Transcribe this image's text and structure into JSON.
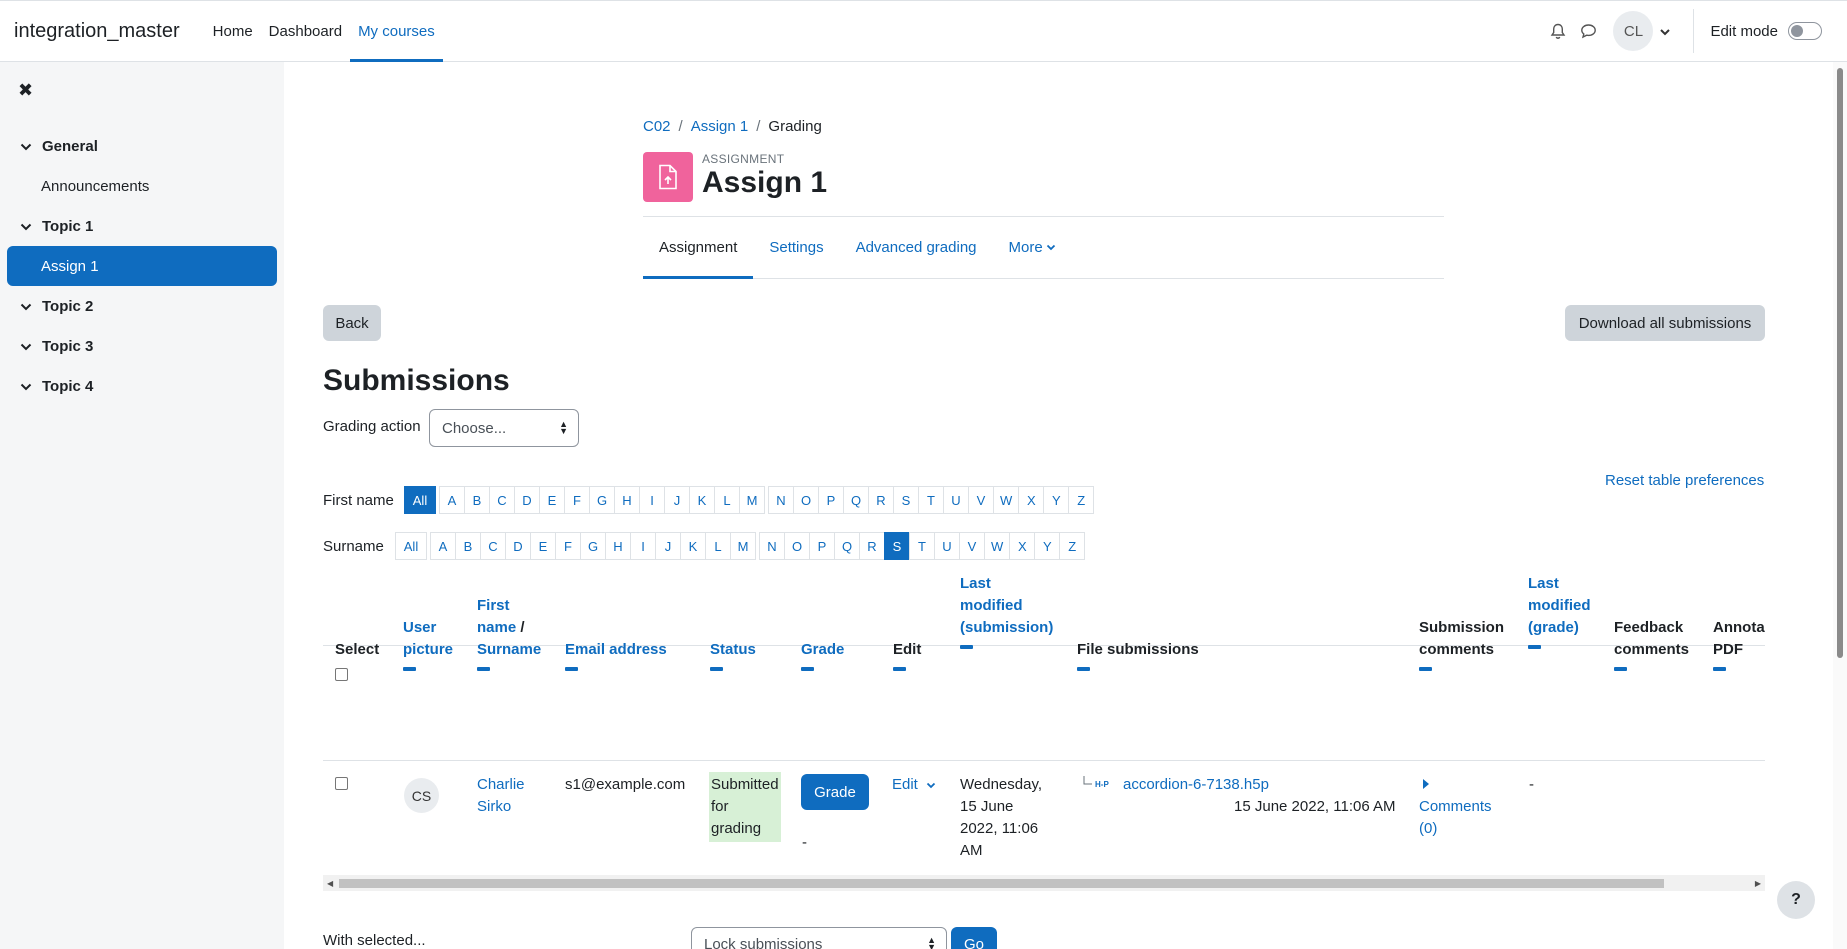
{
  "navbar": {
    "site_name": "integration_master",
    "items": [
      {
        "label": "Home"
      },
      {
        "label": "Dashboard"
      },
      {
        "label": "My courses"
      }
    ],
    "user_initials": "CL",
    "edit_mode_label": "Edit mode"
  },
  "sidebar": {
    "items": [
      {
        "label": "General",
        "type": "section"
      },
      {
        "label": "Announcements",
        "type": "sub"
      },
      {
        "label": "Topic 1",
        "type": "section"
      },
      {
        "label": "Assign 1",
        "type": "sub",
        "active": true
      },
      {
        "label": "Topic 2",
        "type": "section"
      },
      {
        "label": "Topic 3",
        "type": "section"
      },
      {
        "label": "Topic 4",
        "type": "section"
      }
    ]
  },
  "breadcrumb": [
    "C02",
    "Assign 1",
    "Grading"
  ],
  "activity": {
    "type_label": "ASSIGNMENT",
    "title": "Assign 1"
  },
  "tabs": [
    {
      "label": "Assignment",
      "active": true
    },
    {
      "label": "Settings"
    },
    {
      "label": "Advanced grading"
    },
    {
      "label": "More"
    }
  ],
  "buttons": {
    "back": "Back",
    "download_all": "Download all submissions",
    "grade": "Grade",
    "go": "Go",
    "help": "?"
  },
  "submissions": {
    "heading": "Submissions",
    "grading_action_label": "Grading action",
    "grading_action_value": "Choose...",
    "reset_prefs": "Reset table preferences",
    "first_name_label": "First name",
    "surname_label": "Surname",
    "letters_a_m": [
      "A",
      "B",
      "C",
      "D",
      "E",
      "F",
      "G",
      "H",
      "I",
      "J",
      "K",
      "L",
      "M"
    ],
    "letters_n_z": [
      "N",
      "O",
      "P",
      "Q",
      "R",
      "S",
      "T",
      "U",
      "V",
      "W",
      "X",
      "Y",
      "Z"
    ],
    "all_label": "All",
    "first_name_selected": "All",
    "surname_selected": "S"
  },
  "table": {
    "headers": {
      "select": "Select",
      "user_picture_1": "User",
      "user_picture_2": "picture",
      "first_name_1": "First",
      "first_name_2": "name",
      "slash": " /",
      "surname": "Surname",
      "email": "Email address",
      "status": "Status",
      "grade": "Grade",
      "edit": "Edit",
      "last_modified_1": "Last",
      "last_modified_2": "modified",
      "last_modified_3": "(submission)",
      "file_submissions": "File submissions",
      "submission_comments_1": "Submission",
      "submission_comments_2": "comments",
      "last_modified_grade_1": "Last",
      "last_modified_grade_2": "modified",
      "last_modified_grade_3": "(grade)",
      "feedback_comments_1": "Feedback",
      "feedback_comments_2": "comments",
      "annotate_1": "Annota",
      "annotate_2": "PDF"
    },
    "row": {
      "avatar_initials": "CS",
      "first_name": "Charlie",
      "surname": "Sirko",
      "email": "s1@example.com",
      "status_1": "Submitted",
      "status_2": "for",
      "status_3": "grading",
      "grade_value": "-",
      "edit_label": "Edit",
      "last_modified_1": "Wednesday,",
      "last_modified_2": "15 June",
      "last_modified_3": "2022, 11:06",
      "last_modified_4": "AM",
      "file_icon_label": "H-P",
      "file_name": "accordion-6-7138.h5p",
      "file_date": "15 June 2022, 11:06 AM",
      "comments_1": "Comments",
      "comments_2": "(0)",
      "last_modified_grade": "-"
    }
  },
  "footer": {
    "with_selected": "With selected...",
    "lock_select_value": "Lock submissions"
  },
  "colors": {
    "primary": "#0f6cbf",
    "activity_icon": "#f0639c",
    "status_bg": "#d7f0d6"
  }
}
